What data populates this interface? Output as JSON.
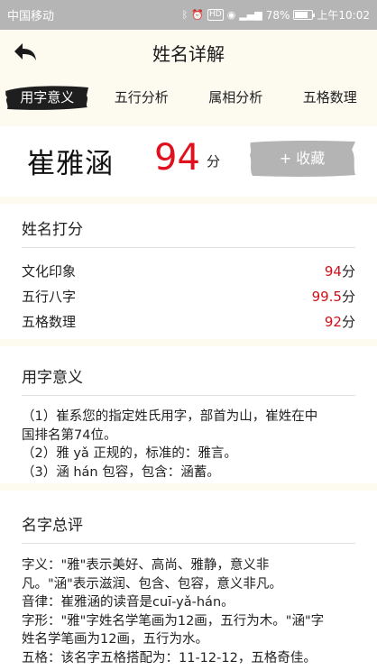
{
  "status_bar": {
    "carrier": "中国移动",
    "battery_percent": "78%",
    "battery_level": 0.78,
    "time": "上午10:02",
    "hd_label": "HD"
  },
  "header": {
    "title": "姓名详解"
  },
  "tabs": [
    {
      "label": "用字意义",
      "active": true
    },
    {
      "label": "五行分析",
      "active": false
    },
    {
      "label": "属相分析",
      "active": false
    },
    {
      "label": "五格数理",
      "active": false
    }
  ],
  "name_card": {
    "name": "崔雅涵",
    "score": "94",
    "score_unit": "分",
    "favorite_label": "+ 收藏"
  },
  "rating": {
    "title": "姓名打分",
    "rows": [
      {
        "label": "文化印象",
        "value": "94",
        "unit": "分"
      },
      {
        "label": "五行八字",
        "value": "99.5",
        "unit": "分"
      },
      {
        "label": "五格数理",
        "value": "92",
        "unit": "分"
      }
    ]
  },
  "meaning": {
    "title": "用字意义",
    "lines": [
      "（1）崔系您的指定姓氏用字，部首为山，崔姓在中",
      "国排名第74位。",
      "（2）雅 yǎ 正规的，标准的：雅言。",
      "（3）涵 hán 包容，包含：涵蓄。"
    ]
  },
  "review": {
    "title": "名字总评",
    "lines": [
      "字义：\"雅\"表示美好、高尚、雅静，意义非",
      "凡。\"涵\"表示滋润、包含、包容，意义非凡。",
      "音律：崔雅涵的读音是cuī-yǎ-hán。",
      "字形：\"雅\"字姓名学笔画为12画，五行为木。\"涵\"字",
      "姓名学笔画为12画，五行为水。",
      "五格：该名字五格搭配为：11-12-12，五格奇佳。"
    ]
  },
  "colors": {
    "score_red": "#e0101e",
    "background": "#fdfaf0",
    "status_bar": "#b5b5b5",
    "brush": "#1e1e1e",
    "fav_brush": "#b4b4b4"
  }
}
